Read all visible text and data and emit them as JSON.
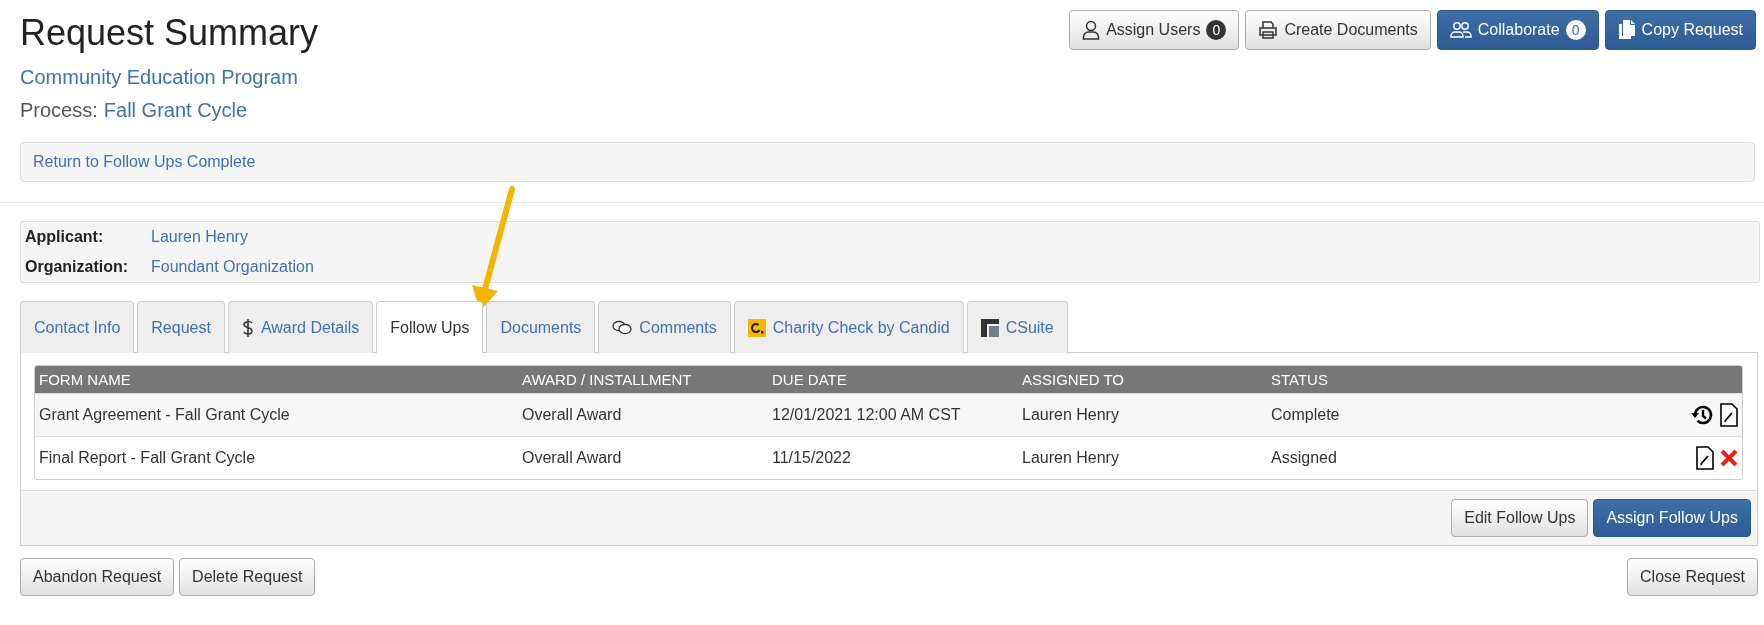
{
  "header": {
    "title": "Request Summary",
    "program": "Community Education Program",
    "process_label": "Process:",
    "process": "Fall Grant Cycle"
  },
  "top_buttons": [
    {
      "kind": "user",
      "label": "Assign Users",
      "count": "0",
      "primary": false
    },
    {
      "kind": "printer",
      "label": "Create Documents",
      "primary": false
    },
    {
      "kind": "users",
      "label": "Collaborate",
      "count": "0",
      "primary": true
    },
    {
      "kind": "copy",
      "label": "Copy Request",
      "primary": true
    }
  ],
  "return_link": "Return to Follow Ups Complete",
  "info": [
    {
      "label": "Applicant:",
      "value": "Lauren Henry"
    },
    {
      "label": "Organization:",
      "value": "Foundant Organization"
    }
  ],
  "tabs": [
    {
      "kind": "plain",
      "label": "Contact Info",
      "selected": false
    },
    {
      "kind": "plain",
      "label": "Request",
      "selected": false
    },
    {
      "kind": "dollar",
      "label": "Award Details",
      "selected": false
    },
    {
      "kind": "plain",
      "label": "Follow Ups",
      "selected": true
    },
    {
      "kind": "plain",
      "label": "Documents",
      "selected": false
    },
    {
      "kind": "comments",
      "label": "Comments",
      "selected": false
    },
    {
      "kind": "candid",
      "label": "Charity Check by Candid",
      "selected": false
    },
    {
      "kind": "csuite",
      "label": "CSuite",
      "selected": false
    }
  ],
  "table": {
    "columns": [
      "FORM NAME",
      "AWARD / INSTALLMENT",
      "DUE DATE",
      "ASSIGNED TO",
      "STATUS"
    ],
    "rows": [
      {
        "cells": [
          "Grant Agreement - Fall Grant Cycle",
          "Overall Award",
          "12/01/2021 12:00 AM CST",
          "Lauren Henry",
          "Complete"
        ],
        "actions": [
          {
            "kind": "history"
          },
          {
            "kind": "form"
          }
        ]
      },
      {
        "cells": [
          "Final Report - Fall Grant Cycle",
          "Overall Award",
          "11/15/2022",
          "Lauren Henry",
          "Assigned"
        ],
        "actions": [
          {
            "kind": "form"
          },
          {
            "kind": "delete"
          }
        ]
      }
    ]
  },
  "panel_buttons": [
    {
      "label": "Edit Follow Ups",
      "primary": false
    },
    {
      "label": "Assign Follow Ups",
      "primary": true
    }
  ],
  "bottom_left_buttons": [
    "Abandon Request",
    "Delete Request"
  ],
  "bottom_right_buttons": [
    "Close Request"
  ],
  "annotation": {
    "kind": "arrow"
  }
}
